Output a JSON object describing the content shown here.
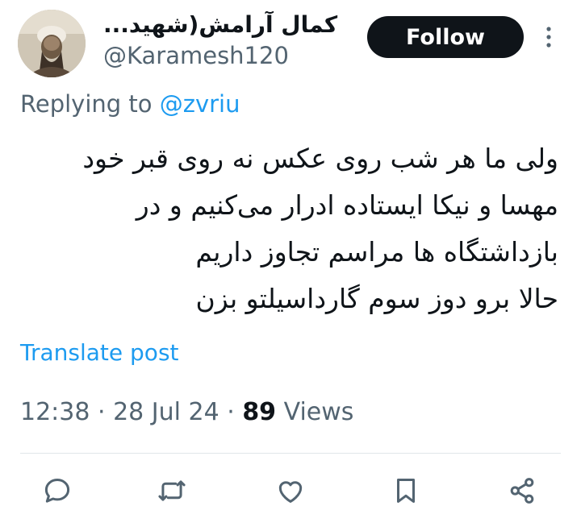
{
  "author": {
    "display_name": "کمال آرامش(شهید...",
    "handle": "@Karamesh120",
    "avatar_icon": "profile-photo"
  },
  "header": {
    "follow_label": "Follow",
    "more_icon": "vertical-ellipsis-icon"
  },
  "reply": {
    "prefix": "Replying to",
    "target": "@zvriu"
  },
  "post": {
    "lines": [
      "ولی ما هر شب روی عکس نه روی قبر خود",
      "مهسا و نیکا ایستاده ادرار می‌کنیم و در",
      "بازداشتگاه ها مراسم تجاوز داریم",
      "حالا برو دوز سوم گارداسیلتو بزن"
    ],
    "translate_label": "Translate post"
  },
  "meta": {
    "time": "12:38",
    "separator": " · ",
    "date": "28 Jul 24",
    "views_count": "89",
    "views_label": " Views"
  },
  "actions": {
    "icons": [
      "reply-icon",
      "repost-icon",
      "like-icon",
      "bookmark-icon",
      "share-icon"
    ]
  },
  "colors": {
    "accent": "#1d9bf0",
    "text": "#0f1419",
    "muted": "#536471"
  }
}
